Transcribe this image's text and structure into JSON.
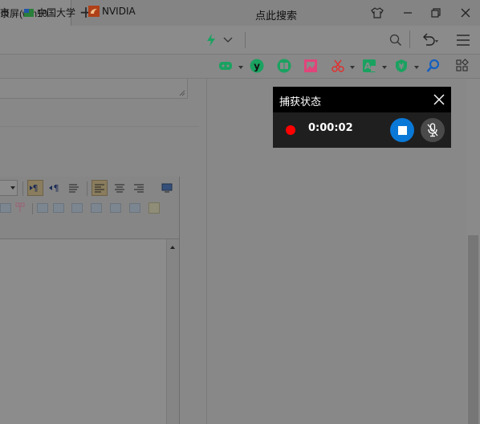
{
  "browser": {
    "tab_title": "录屏(win10",
    "new_tab_glyph": "+",
    "window_icons": [
      "tshirt-icon",
      "minimize-icon",
      "restore-icon",
      "close-icon"
    ],
    "search_placeholder": "点此搜索",
    "address_icons": [
      "lightning-icon",
      "chevron-down-icon",
      "search-icon",
      "undo-icon",
      "menu-icon"
    ]
  },
  "bookmarks": [
    {
      "label": "市",
      "icon": "partial-icon"
    },
    {
      "label": "中国大学",
      "icon": "globe-flag-icon"
    },
    {
      "label": "NVIDIA",
      "icon": "nvidia-icon"
    }
  ],
  "extensions": [
    {
      "name": "gamepad-icon",
      "color": "#1aa260"
    },
    {
      "name": "v-circle-icon",
      "color": "#1aa260"
    },
    {
      "name": "book-icon",
      "color": "#1aa260"
    },
    {
      "name": "image-icon",
      "color": "#e0447a"
    },
    {
      "name": "scissors-icon",
      "color": "#e03030"
    },
    {
      "name": "translate-icon",
      "color": "#1aa260"
    },
    {
      "name": "yen-shield-icon",
      "color": "#1aa260"
    },
    {
      "name": "magnifier-icon",
      "color": "#1560c0"
    },
    {
      "name": "apps-icon",
      "color": "#333333"
    }
  ],
  "editor": {
    "toolbar_row1": [
      "ltr-paragraph-icon",
      "rtl-paragraph-icon",
      "list-icon",
      "align-left-icon",
      "align-center-icon",
      "align-right-icon",
      "preview-icon"
    ],
    "active_buttons": [
      "ltr-paragraph-icon",
      "align-left-icon"
    ]
  },
  "capture_status": {
    "title": "捕获状态",
    "elapsed": "0:00:02",
    "colors": {
      "header": "#000000",
      "body": "#1f1f1f",
      "record_dot": "#ff0000",
      "stop_button": "#0a78d7"
    }
  }
}
